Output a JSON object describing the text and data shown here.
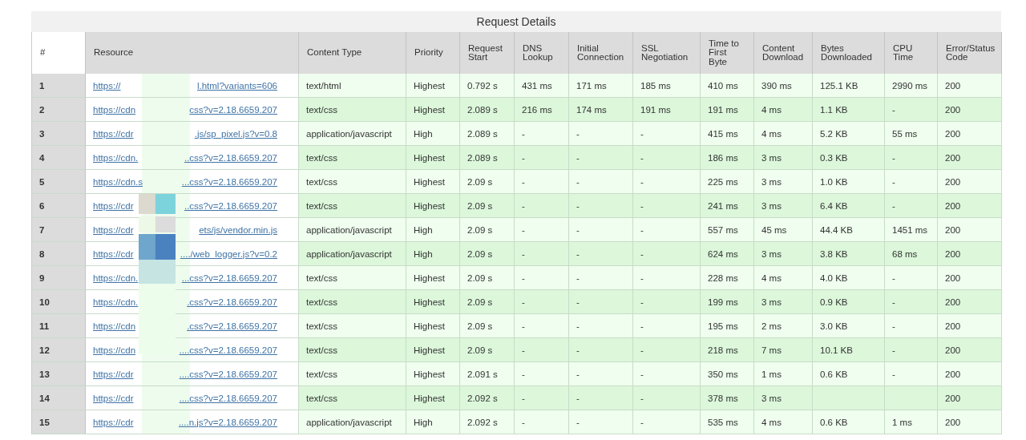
{
  "title": "Request Details",
  "columns": [
    "#",
    "Resource",
    "Content Type",
    "Priority",
    "Request Start",
    "DNS Lookup",
    "Initial Connection",
    "SSL Negotiation",
    "Time to First Byte",
    "Content Download",
    "Bytes Downloaded",
    "CPU Time",
    "Error/Status Code"
  ],
  "rows": [
    {
      "number": "1",
      "resource_start": "https://",
      "resource_end": "l.html?variants=606",
      "cells": [
        "text/html",
        "Highest",
        "0.792 s",
        "431 ms",
        "171 ms",
        "185 ms",
        "410 ms",
        "390 ms",
        "125.1 KB",
        "2990 ms",
        "200"
      ]
    },
    {
      "number": "2",
      "resource_start": "https://cdn",
      "resource_end": "css?v=2.18.6659.207",
      "cells": [
        "text/css",
        "Highest",
        "2.089 s",
        "216 ms",
        "174 ms",
        "191 ms",
        "191 ms",
        "4 ms",
        "1.1 KB",
        "-",
        "200"
      ]
    },
    {
      "number": "3",
      "resource_start": "https://cdr",
      "resource_end": ".js/sp_pixel.js?v=0.8",
      "cells": [
        "application/javascript",
        "High",
        "2.089 s",
        "-",
        "-",
        "-",
        "415 ms",
        "4 ms",
        "5.2 KB",
        "55 ms",
        "200"
      ]
    },
    {
      "number": "4",
      "resource_start": "https://cdn.",
      "resource_end": "..css?v=2.18.6659.207",
      "cells": [
        "text/css",
        "Highest",
        "2.089 s",
        "-",
        "-",
        "-",
        "186 ms",
        "3 ms",
        "0.3 KB",
        "-",
        "200"
      ]
    },
    {
      "number": "5",
      "resource_start": "https://cdn.s",
      "resource_end": "...css?v=2.18.6659.207",
      "cells": [
        "text/css",
        "Highest",
        "2.09 s",
        "-",
        "-",
        "-",
        "225 ms",
        "3 ms",
        "1.0 KB",
        "-",
        "200"
      ]
    },
    {
      "number": "6",
      "resource_start": "https://cdr",
      "resource_end": "..css?v=2.18.6659.207",
      "cells": [
        "text/css",
        "Highest",
        "2.09 s",
        "-",
        "-",
        "-",
        "241 ms",
        "3 ms",
        "6.4 KB",
        "-",
        "200"
      ]
    },
    {
      "number": "7",
      "resource_start": "https://cdr",
      "resource_end": "ets/js/vendor.min.js",
      "cells": [
        "application/javascript",
        "High",
        "2.09 s",
        "-",
        "-",
        "-",
        "557 ms",
        "45 ms",
        "44.4 KB",
        "1451 ms",
        "200"
      ]
    },
    {
      "number": "8",
      "resource_start": "https://cdr",
      "resource_end": "..../web_logger.js?v=0.2",
      "cells": [
        "application/javascript",
        "High",
        "2.09 s",
        "-",
        "-",
        "-",
        "624 ms",
        "3 ms",
        "3.8 KB",
        "68 ms",
        "200"
      ]
    },
    {
      "number": "9",
      "resource_start": "https://cdn.",
      "resource_end": "...css?v=2.18.6659.207",
      "cells": [
        "text/css",
        "Highest",
        "2.09 s",
        "-",
        "-",
        "-",
        "228 ms",
        "4 ms",
        "4.0 KB",
        "-",
        "200"
      ]
    },
    {
      "number": "10",
      "resource_start": "https://cdn.",
      "resource_end": ".css?v=2.18.6659.207",
      "cells": [
        "text/css",
        "Highest",
        "2.09 s",
        "-",
        "-",
        "-",
        "199 ms",
        "3 ms",
        "0.9 KB",
        "-",
        "200"
      ]
    },
    {
      "number": "11",
      "resource_start": "https://cdn",
      "resource_end": ".css?v=2.18.6659.207",
      "cells": [
        "text/css",
        "Highest",
        "2.09 s",
        "-",
        "-",
        "-",
        "195 ms",
        "2 ms",
        "3.0 KB",
        "-",
        "200"
      ]
    },
    {
      "number": "12",
      "resource_start": "https://cdn",
      "resource_end": "....css?v=2.18.6659.207",
      "cells": [
        "text/css",
        "Highest",
        "2.09 s",
        "-",
        "-",
        "-",
        "218 ms",
        "7 ms",
        "10.1 KB",
        "-",
        "200"
      ]
    },
    {
      "number": "13",
      "resource_start": "https://cdr",
      "resource_end": "....css?v=2.18.6659.207",
      "cells": [
        "text/css",
        "Highest",
        "2.091 s",
        "-",
        "-",
        "-",
        "350 ms",
        "1 ms",
        "0.6 KB",
        "-",
        "200"
      ]
    },
    {
      "number": "14",
      "resource_start": "https://cdr",
      "resource_end": "....css?v=2.18.6659.207",
      "cells": [
        "text/css",
        "Highest",
        "2.092 s",
        "-",
        "-",
        "-",
        "378 ms",
        "3 ms",
        "",
        "",
        "200"
      ]
    },
    {
      "number": "15",
      "resource_start": "https://cdr",
      "resource_end": "....n.js?v=2.18.6659.207",
      "cells": [
        "application/javascript",
        "High",
        "2.092 s",
        "-",
        "-",
        "-",
        "535 ms",
        "4 ms",
        "0.6 KB",
        "1 ms",
        "200"
      ]
    }
  ]
}
